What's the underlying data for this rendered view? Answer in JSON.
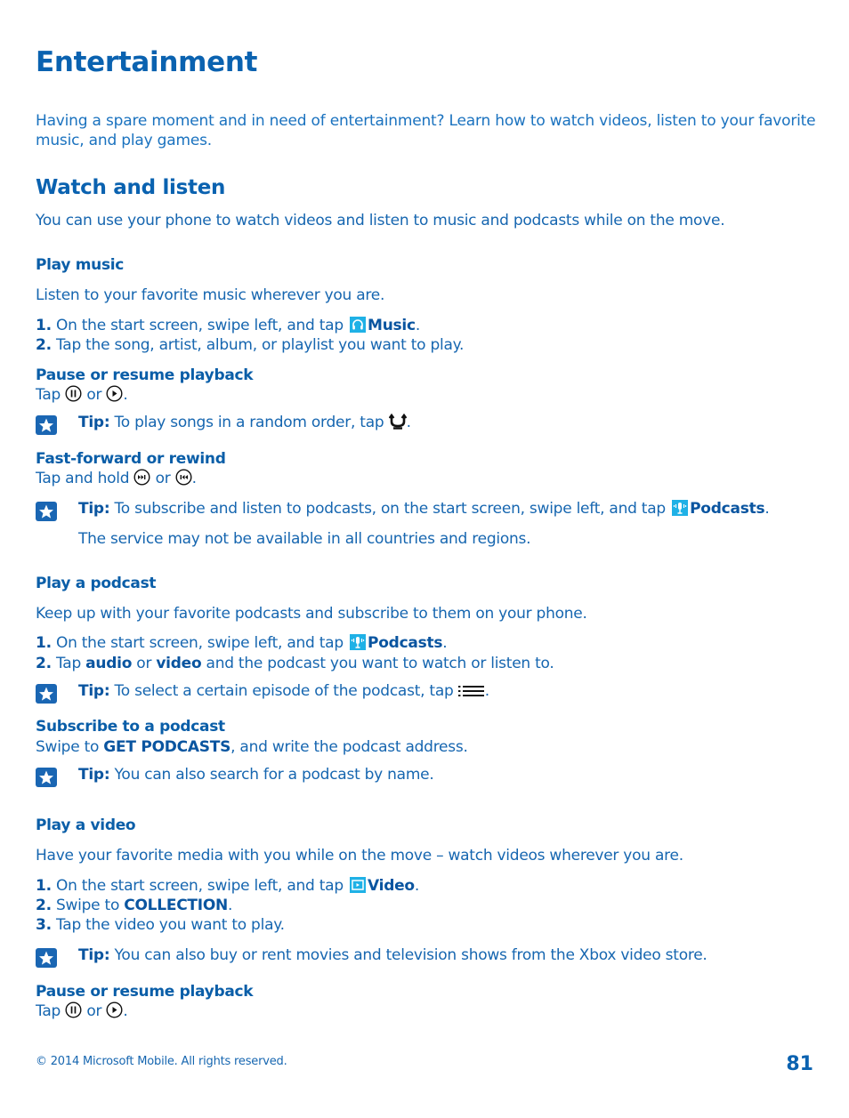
{
  "page": {
    "title": "Entertainment",
    "intro": "Having a spare moment and in need of entertainment? Learn how to watch videos, listen to your favorite music, and play games.",
    "section": {
      "title": "Watch and listen",
      "intro": "You can use your phone to watch videos and listen to music and podcasts while on the move."
    },
    "play_music": {
      "title": "Play music",
      "intro": "Listen to your favorite music wherever you are.",
      "step1": {
        "num": "1.",
        "text": "On the start screen, swipe left, and tap",
        "app": "Music",
        "end": "."
      },
      "step2": {
        "num": "2.",
        "text": "Tap the song, artist, album, or playlist you want to play."
      },
      "pause": {
        "title": "Pause or resume playback",
        "pre": "Tap",
        "mid": "or",
        "end": "."
      },
      "tip1": {
        "label": "Tip:",
        "text": "To play songs in a random order, tap",
        "end": "."
      },
      "ff": {
        "title": "Fast-forward or rewind",
        "pre": "Tap and hold",
        "mid": "or",
        "end": "."
      },
      "tip2": {
        "label": "Tip:",
        "text": "To subscribe and listen to podcasts, on the start screen, swipe left, and tap",
        "app": "Podcasts",
        "end": ".",
        "note": "The service may not be available in all countries and regions."
      }
    },
    "podcast": {
      "title": "Play a podcast",
      "intro": "Keep up with your favorite podcasts and subscribe to them on your phone.",
      "step1": {
        "num": "1.",
        "text": "On the start screen, swipe left, and tap",
        "app": "Podcasts",
        "end": "."
      },
      "step2": {
        "num": "2.",
        "pre": "Tap",
        "b1": "audio",
        "mid": "or",
        "b2": "video",
        "post": "and the podcast you want to watch or listen to."
      },
      "tip": {
        "label": "Tip:",
        "text": "To select a certain episode of the podcast, tap",
        "end": "."
      },
      "subscribe": {
        "title": "Subscribe to a podcast",
        "pre": "Swipe to",
        "b": "GET PODCASTS",
        "post": ", and write the podcast address."
      },
      "tip2": {
        "label": "Tip:",
        "text": "You can also search for a podcast by name."
      }
    },
    "video": {
      "title": "Play a video",
      "intro": "Have your favorite media with you while on the move – watch videos wherever you are.",
      "step1": {
        "num": "1.",
        "text": "On the start screen, swipe left, and tap",
        "app": "Video",
        "end": "."
      },
      "step2": {
        "num": "2.",
        "pre": "Swipe to",
        "b": "COLLECTION",
        "end": "."
      },
      "step3": {
        "num": "3.",
        "text": "Tap the video you want to play."
      },
      "tip": {
        "label": "Tip:",
        "text": "You can also buy or rent movies and television shows from the Xbox video store."
      },
      "pause": {
        "title": "Pause or resume playback",
        "pre": "Tap",
        "mid": "or",
        "end": "."
      }
    },
    "footer": {
      "copyright": "© 2014 Microsoft Mobile. All rights reserved.",
      "page_number": "81"
    }
  }
}
